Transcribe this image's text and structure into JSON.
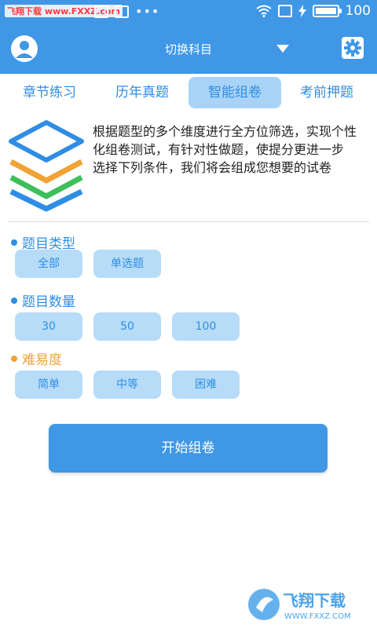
{
  "status_bar": {
    "watermark": "飞翔下载 www.FXXZ.com",
    "battery_text": "100",
    "battery_level": 1.0,
    "icons": [
      "gallery-icon",
      "news-icon",
      "more-dots-icon",
      "wifi-icon",
      "sim-icon",
      "charging-icon",
      "battery-icon"
    ]
  },
  "app_bar": {
    "title": "切换科目",
    "icons": [
      "avatar-icon",
      "dropdown-caret-icon",
      "settings-gear-icon"
    ]
  },
  "tabs": [
    {
      "label": "章节练习",
      "active": false
    },
    {
      "label": "历年真题",
      "active": false
    },
    {
      "label": "智能组卷",
      "active": true
    },
    {
      "label": "考前押题",
      "active": false
    }
  ],
  "intro": {
    "text": "根据题型的多个维度进行全方位筛选，实现个性化组卷测试，有针对性做题，使提分更进一步",
    "text2": "选择下列条件，我们将会组成您想要的试卷",
    "icon": "layers-stack-icon"
  },
  "sections": {
    "type": {
      "title": "题目类型",
      "options": [
        "全部",
        "单选题"
      ]
    },
    "count": {
      "title": "题目数量",
      "options": [
        "30",
        "50",
        "100"
      ]
    },
    "difficulty": {
      "title": "难易度",
      "options": [
        "简单",
        "中等",
        "困难"
      ]
    }
  },
  "start_button": "开始组卷",
  "corner_watermark": {
    "text": "飞翔下载",
    "url": "WWW.FXXZ.COM"
  },
  "colors": {
    "primary": "#3f97e6",
    "chip": "#b6dcf8",
    "orange": "#f0a336",
    "green": "#3fbf5b"
  }
}
